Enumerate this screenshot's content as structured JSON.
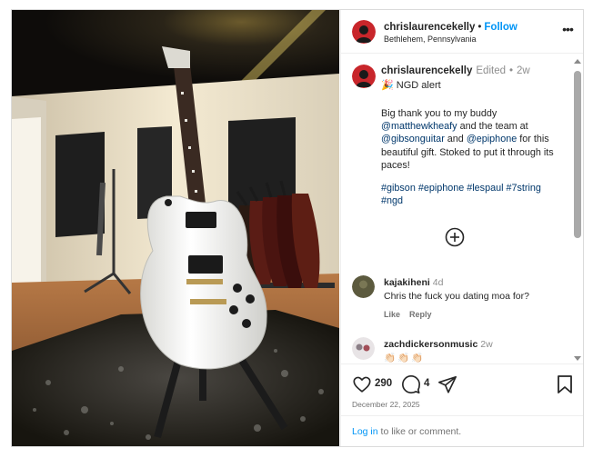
{
  "header": {
    "username": "chrislaurencekelly",
    "separator": "•",
    "follow_label": "Follow",
    "location": "Bethlehem, Pennsylvania",
    "more_icon": "more-horizontal-icon"
  },
  "caption": {
    "username": "chrislaurencekelly",
    "edited": "Edited",
    "dot": "•",
    "time": "2w",
    "alert_icon": "🎉",
    "alert_text": "NGD alert",
    "text_1": "Big thank you to my buddy ",
    "mention_1": "@matthewkheafy",
    "text_2": " and the team at ",
    "mention_2": "@gibsonguitar",
    "text_3": " and ",
    "mention_3": "@epiphone",
    "text_4": " for this beautiful gift. Stoked to put it through its paces!",
    "tags": [
      "#gibson",
      "#epiphone",
      "#lespaul",
      "#7string",
      "#ngd"
    ]
  },
  "comments": [
    {
      "username": "kajakiheni",
      "time": "4d",
      "text": "Chris the fuck you dating moa for?",
      "like_label": "Like",
      "reply_label": "Reply"
    },
    {
      "username": "zachdickersonmusic",
      "time": "2w",
      "text": "👏🏻👏🏻👏🏻"
    }
  ],
  "actions": {
    "likes": "290",
    "comments": "4",
    "date": "December 22, 2025"
  },
  "login": {
    "link": "Log in",
    "rest": " to like or comment."
  },
  "colors": {
    "accent": "#0095f6",
    "link": "#00376b",
    "muted": "#737373",
    "avatar_red": "#c8262b"
  }
}
